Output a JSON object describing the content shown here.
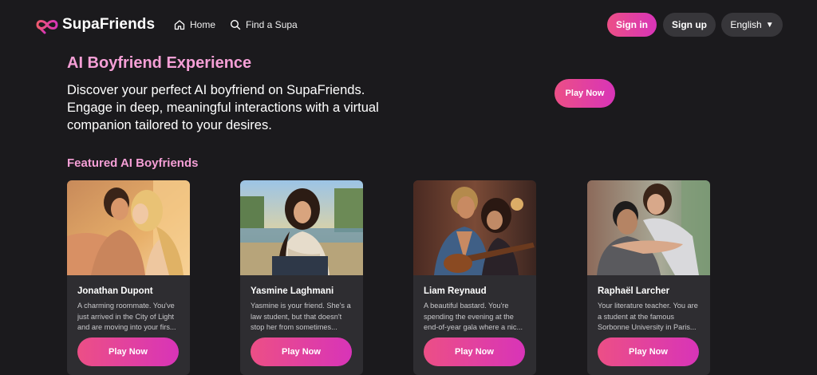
{
  "brand": {
    "name": "SupaFriends",
    "icon": "infinity-heart-logo",
    "accent": "#ec4f86",
    "accent2": "#d834b8"
  },
  "nav": {
    "home_label": "Home",
    "find_label": "Find a Supa",
    "signin_label": "Sign in",
    "signup_label": "Sign up",
    "language_label": "English",
    "language_caret": "▼"
  },
  "hero": {
    "title": "AI Boyfriend Experience",
    "description": "Discover your perfect AI boyfriend on SupaFriends. Engage in deep, meaningful interactions with a virtual companion tailored to your desires.",
    "play_label": "Play Now"
  },
  "featured": {
    "title": "Featured AI Boyfriends",
    "cards": [
      {
        "name": "Jonathan Dupont",
        "description": "A charming roommate. You've just arrived in the City of Light and are moving into your firs...",
        "play_label": "Play Now"
      },
      {
        "name": "Yasmine Laghmani",
        "description": "Yasmine is your friend. She's a law student, but that doesn't stop her from sometimes...",
        "play_label": "Play Now"
      },
      {
        "name": "Liam Reynaud",
        "description": "A beautiful bastard. You're spending the evening at the end-of-year gala where a nic...",
        "play_label": "Play Now"
      },
      {
        "name": "Raphaël Larcher",
        "description": "Your literature teacher. You are a student at the famous Sorbonne University in Paris...",
        "play_label": "Play Now"
      }
    ]
  }
}
